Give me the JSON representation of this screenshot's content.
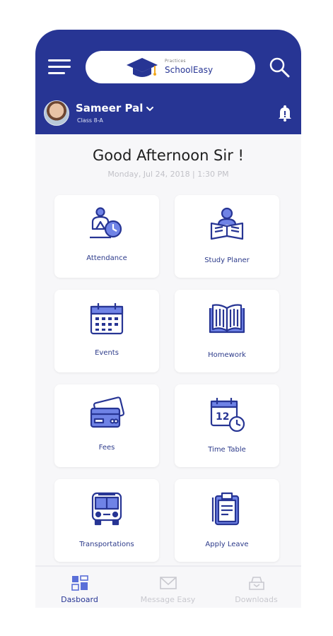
{
  "header": {
    "logo_small": "Practices",
    "logo_text": "SchoolEasy",
    "user_name": "Sameer Pal",
    "user_class": "Class 8-A"
  },
  "greeting": {
    "title": "Good Afternoon Sir !",
    "datetime": "Monday, Jul 24, 2018  |  1:30 PM"
  },
  "tiles": [
    {
      "label": "Attendance",
      "icon": "attendance-icon"
    },
    {
      "label": "Study Planer",
      "icon": "study-planner-icon"
    },
    {
      "label": "Events",
      "icon": "calendar-icon"
    },
    {
      "label": "Homework",
      "icon": "open-book-icon"
    },
    {
      "label": "Fees",
      "icon": "cards-icon"
    },
    {
      "label": "Time Table",
      "icon": "calendar-clock-icon"
    },
    {
      "label": "Transportations",
      "icon": "bus-icon"
    },
    {
      "label": "Apply Leave",
      "icon": "clipboard-icon"
    }
  ],
  "footer": {
    "tabs": [
      {
        "label": "Dasboard",
        "active": true
      },
      {
        "label": "Message Easy",
        "active": false
      },
      {
        "label": "Downloads",
        "active": false
      }
    ]
  },
  "colors": {
    "primary": "#273594",
    "background": "#f7f7f9",
    "tab_inactive": "#c9c9cf"
  }
}
